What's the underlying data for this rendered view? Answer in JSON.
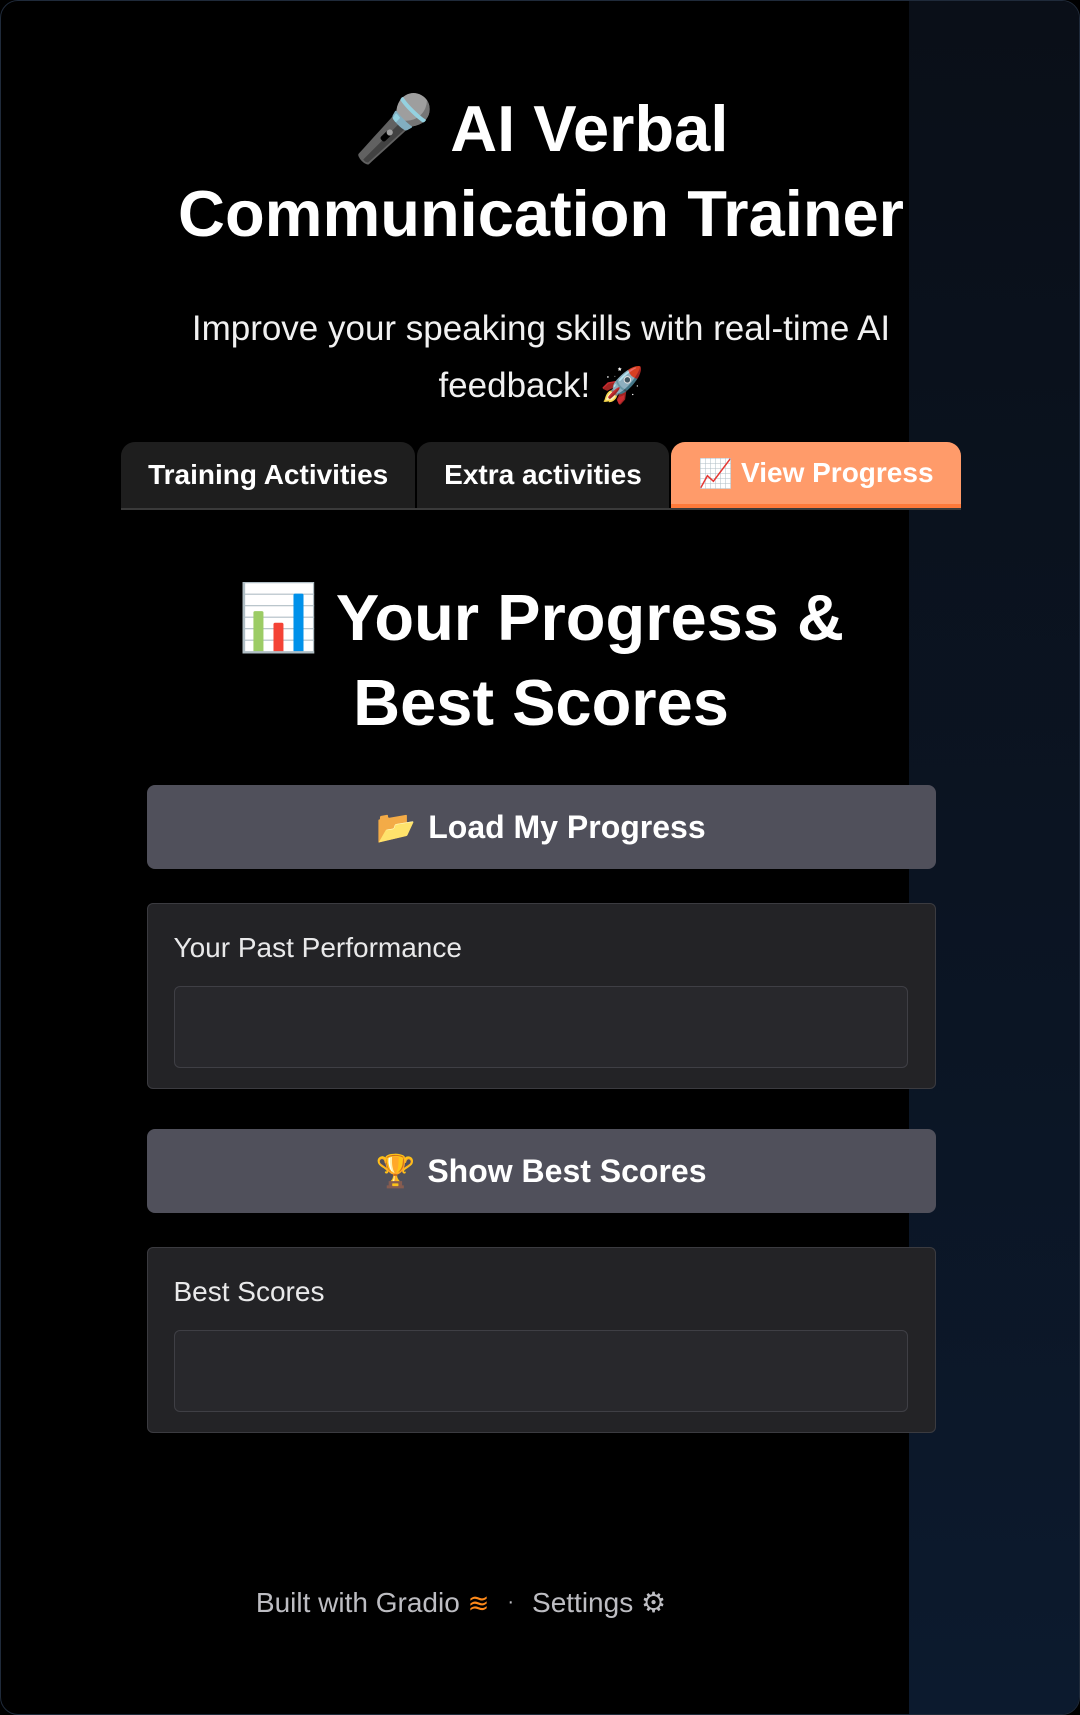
{
  "header": {
    "title_icon": "🎤",
    "title": "AI Verbal Communication Trainer",
    "subtitle": "Improve your speaking skills with real-time AI feedback! 🚀"
  },
  "tabs": [
    {
      "label": "Training Activities",
      "icon": "",
      "active": false
    },
    {
      "label": "Extra activities",
      "icon": "",
      "active": false
    },
    {
      "label": "View Progress",
      "icon": "📈",
      "active": true
    }
  ],
  "progress": {
    "section_icon": "📊",
    "section_title": "Your Progress & Best Scores",
    "load_button": {
      "icon": "📂",
      "label": "Load My Progress"
    },
    "past_performance": {
      "label": "Your Past Performance",
      "value": ""
    },
    "best_button": {
      "icon": "🏆",
      "label": "Show Best Scores"
    },
    "best_scores": {
      "label": "Best Scores",
      "value": ""
    }
  },
  "footer": {
    "built_with": "Built with Gradio",
    "separator": "·",
    "settings": "Settings"
  },
  "colors": {
    "accent_tab": "#ff9b6a",
    "button_bg": "#50505b",
    "panel_bg": "#232326",
    "gradio_orange": "#ff8a1a"
  }
}
